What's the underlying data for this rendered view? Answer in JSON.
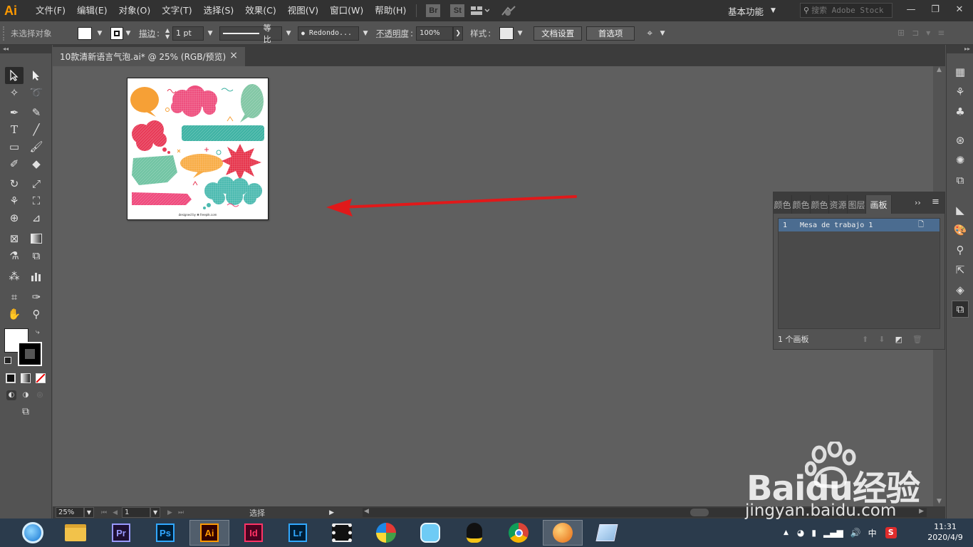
{
  "menubar": {
    "logo": "Ai",
    "items": [
      "文件(F)",
      "编辑(E)",
      "对象(O)",
      "文字(T)",
      "选择(S)",
      "效果(C)",
      "视图(V)",
      "窗口(W)",
      "帮助(H)"
    ],
    "bridge": "Br",
    "stock": "St",
    "workspace": "基本功能",
    "search_placeholder": "搜索 Adobe Stock"
  },
  "controlbar": {
    "selection": "未选择对象",
    "stroke_label": "描边",
    "stroke_value": "1 pt",
    "profile": "等比",
    "brush": "Redondo...",
    "opacity_label": "不透明度",
    "opacity_value": "100%",
    "style_label": "样式",
    "doc_setup": "文档设置",
    "preferences": "首选项"
  },
  "document": {
    "tab_title": "10款清新语言气泡.ai* @ 25% (RGB/预览)",
    "artboard_credit": "designed by ❀ freepik.com"
  },
  "statusbar": {
    "zoom": "25%",
    "artboard_num": "1",
    "tool": "选择"
  },
  "artboards_panel": {
    "tabs": [
      "颜色",
      "颜色",
      "颜色",
      "资源",
      "图层",
      "画板"
    ],
    "active_tab": "画板",
    "rows": [
      {
        "num": "1",
        "name": "Mesa de trabajo 1"
      }
    ],
    "footer": "1 个画板"
  },
  "taskbar": {
    "apps": [
      {
        "label": "Pr",
        "color": "#9999ff",
        "bg": "#1e0f33"
      },
      {
        "label": "Ps",
        "color": "#31a8ff",
        "bg": "#001e36"
      },
      {
        "label": "Ai",
        "color": "#ff9a00",
        "bg": "#330000"
      },
      {
        "label": "Id",
        "color": "#ff3366",
        "bg": "#49021f"
      },
      {
        "label": "Lr",
        "color": "#31a8ff",
        "bg": "#001e36"
      }
    ],
    "tray_lang": "中",
    "time": "11:31",
    "date": "2020/4/9"
  },
  "watermark": {
    "brand": "Baidu经验",
    "url": "jingyan.baidu.com"
  },
  "colors": {
    "accent_orange": "#ff9a00",
    "arrow_red": "#e0191a",
    "selection_blue": "#4b6c90"
  }
}
